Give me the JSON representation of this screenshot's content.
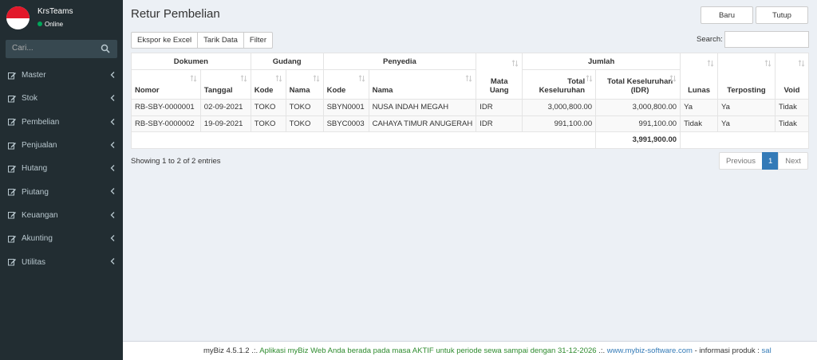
{
  "sidebar": {
    "user_name": "KrsTeams",
    "user_status": "Online",
    "search_placeholder": "Cari...",
    "items": [
      {
        "label": "Master",
        "icon": "edit-icon"
      },
      {
        "label": "Stok",
        "icon": "edit-icon"
      },
      {
        "label": "Pembelian",
        "icon": "edit-icon"
      },
      {
        "label": "Penjualan",
        "icon": "edit-icon"
      },
      {
        "label": "Hutang",
        "icon": "edit-icon"
      },
      {
        "label": "Piutang",
        "icon": "edit-icon"
      },
      {
        "label": "Keuangan",
        "icon": "edit-icon"
      },
      {
        "label": "Akunting",
        "icon": "edit-icon"
      },
      {
        "label": "Utilitas",
        "icon": "edit-icon"
      }
    ]
  },
  "header": {
    "title": "Retur Pembelian",
    "new_label": "Baru",
    "close_label": "Tutup"
  },
  "toolbar": {
    "export_label": "Ekspor ke Excel",
    "pull_label": "Tarik Data",
    "filter_label": "Filter",
    "search_label": "Search:",
    "search_value": ""
  },
  "table": {
    "group_headers": {
      "dokumen": "Dokumen",
      "gudang": "Gudang",
      "penyedia": "Penyedia",
      "jumlah": "Jumlah"
    },
    "columns": {
      "nomor": "Nomor",
      "tanggal": "Tanggal",
      "gudang_kode": "Kode",
      "gudang_nama": "Nama",
      "penyedia_kode": "Kode",
      "penyedia_nama": "Nama",
      "mata_uang": "Mata Uang",
      "total": "Total Keseluruhan",
      "total_idr": "Total Keseluruhan (IDR)",
      "lunas": "Lunas",
      "terposting": "Terposting",
      "void": "Void"
    },
    "rows": [
      {
        "nomor": "RB-SBY-0000001",
        "tanggal": "02-09-2021",
        "gudang_kode": "TOKO",
        "gudang_nama": "TOKO",
        "penyedia_kode": "SBYN0001",
        "penyedia_nama": "NUSA INDAH MEGAH",
        "mata_uang": "IDR",
        "total": "3,000,800.00",
        "total_idr": "3,000,800.00",
        "lunas": "Ya",
        "terposting": "Ya",
        "void": "Tidak"
      },
      {
        "nomor": "RB-SBY-0000002",
        "tanggal": "19-09-2021",
        "gudang_kode": "TOKO",
        "gudang_nama": "TOKO",
        "penyedia_kode": "SBYC0003",
        "penyedia_nama": "CAHAYA TIMUR ANUGERAH",
        "mata_uang": "IDR",
        "total": "991,100.00",
        "total_idr": "991,100.00",
        "lunas": "Tidak",
        "terposting": "Ya",
        "void": "Tidak"
      }
    ],
    "grand_total": "3,991,900.00"
  },
  "pagination": {
    "info": "Showing 1 to 2 of 2 entries",
    "previous": "Previous",
    "current": "1",
    "next": "Next"
  },
  "footer": {
    "version": "myBiz 4.5.1.2",
    "sep1": ".:.",
    "active_msg": "Aplikasi myBiz Web Anda berada pada masa AKTIF untuk periode sewa sampai dengan 31-12-2026",
    "sep2": ".:.",
    "website": "www.mybiz-software.com",
    "info": "- informasi produk :",
    "product_link": "sal"
  },
  "colors": {
    "sidebar_bg": "#222d32",
    "accent": "#337ab7",
    "online": "#00a65a",
    "footer_active": "#2e8b2e"
  }
}
